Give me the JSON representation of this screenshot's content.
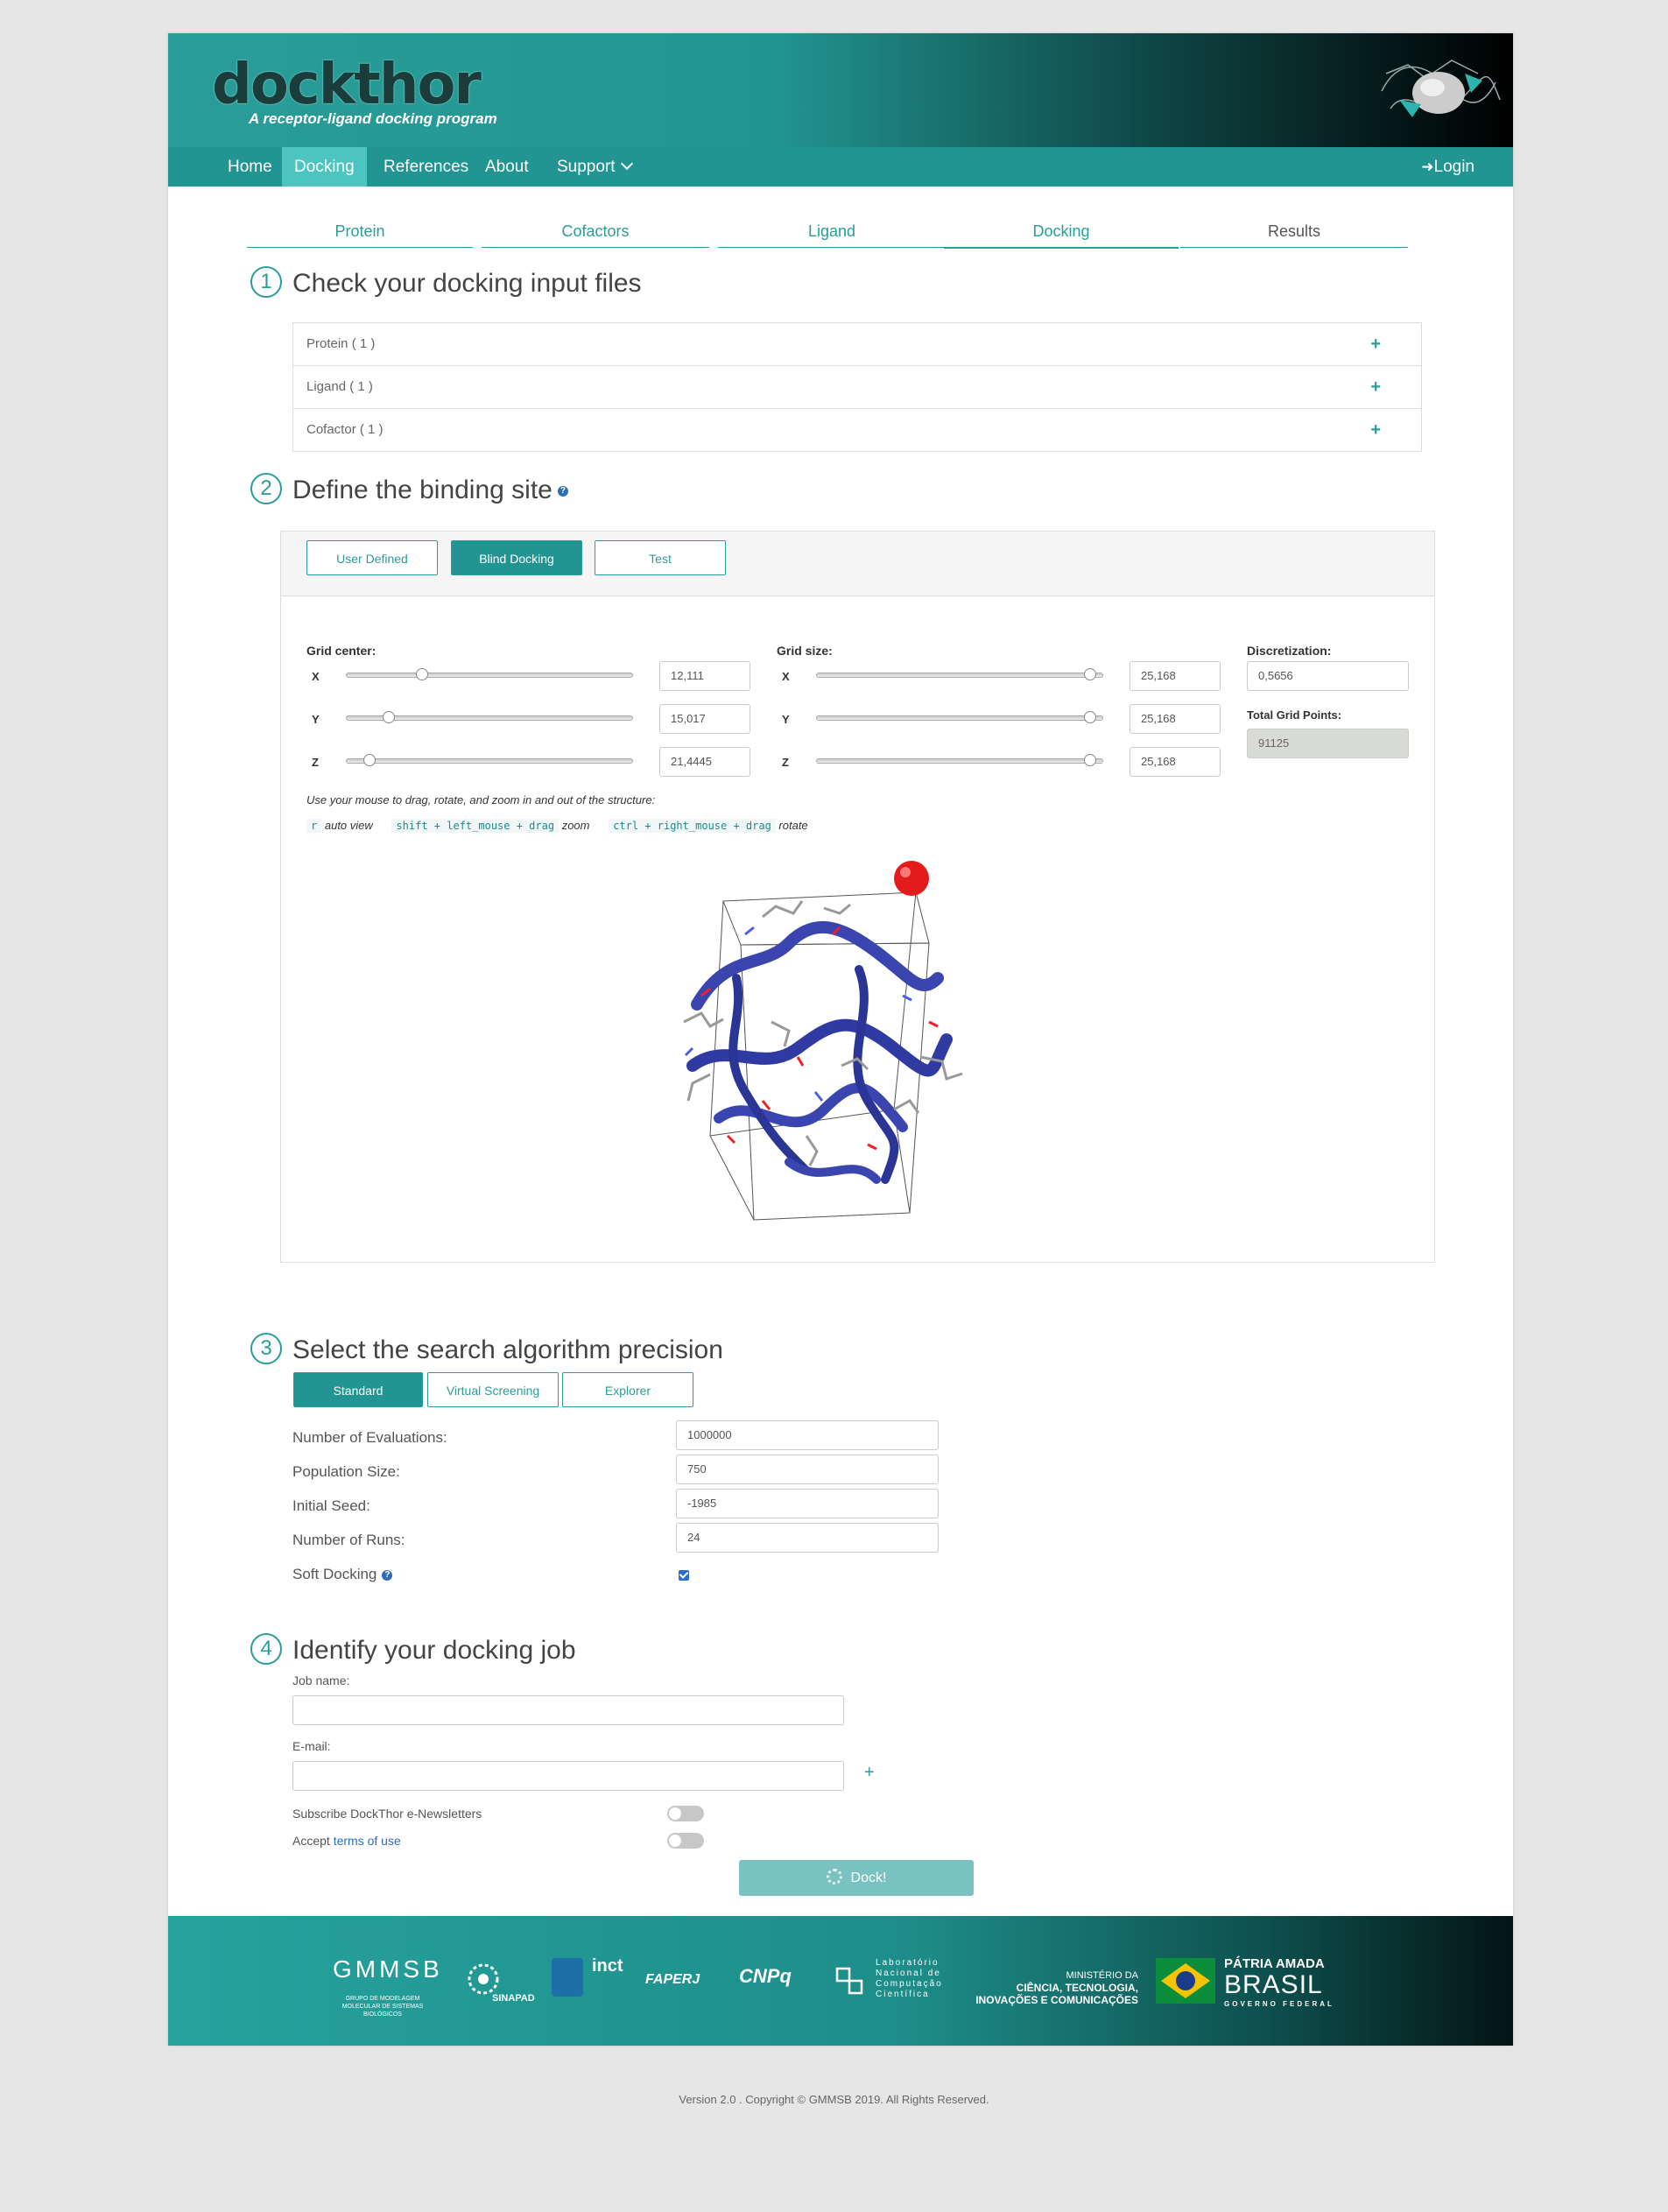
{
  "header": {
    "logo": "dockthor",
    "tagline": "A receptor-ligand docking program"
  },
  "nav": {
    "items": [
      "Home",
      "Docking",
      "References",
      "About",
      "Support"
    ],
    "active": "Docking",
    "login": "Login"
  },
  "steps": [
    "Protein",
    "Cofactors",
    "Ligand",
    "Docking",
    "Results"
  ],
  "section1": {
    "num": "1",
    "title": "Check your docking input files",
    "rows": [
      "Protein ( 1 )",
      "Ligand ( 1 )",
      "Cofactor ( 1 )"
    ],
    "plus": "+"
  },
  "section2": {
    "num": "2",
    "title": "Define the binding site",
    "help": "?",
    "modes": [
      "User Defined",
      "Blind Docking",
      "Test"
    ],
    "active_mode": "Blind Docking",
    "grid_center_label": "Grid center:",
    "grid_size_label": "Grid size:",
    "axes": [
      "X",
      "Y",
      "Z"
    ],
    "grid_center": [
      "12,111",
      "15,017",
      "21,4445"
    ],
    "grid_center_slider": [
      0.25,
      0.13,
      0.06
    ],
    "grid_size": [
      "25,168",
      "25,168",
      "25,168"
    ],
    "grid_size_slider": [
      0.97,
      0.97,
      0.97
    ],
    "discretization_label": "Discretization:",
    "discretization": "0,5656",
    "total_points_label": "Total Grid Points:",
    "total_points": "91125",
    "instructions": "Use your mouse to drag, rotate, and zoom in and out of the structure:",
    "keys": {
      "k1": "r",
      "t1": "auto view",
      "k2": "shift + left_mouse + drag",
      "t2": "zoom",
      "k3": "ctrl + right_mouse + drag",
      "t3": "rotate"
    }
  },
  "section3": {
    "num": "3",
    "title": "Select the search algorithm precision",
    "modes": [
      "Standard",
      "Virtual Screening",
      "Explorer"
    ],
    "active_mode": "Standard",
    "params": [
      {
        "label": "Number of Evaluations:",
        "value": "1000000"
      },
      {
        "label": "Population Size:",
        "value": "750"
      },
      {
        "label": "Initial Seed:",
        "value": "-1985"
      },
      {
        "label": "Number of Runs:",
        "value": "24"
      }
    ],
    "soft_docking": "Soft Docking",
    "soft_docking_checked": true
  },
  "section4": {
    "num": "4",
    "title": "Identify your docking job",
    "job_name_label": "Job name:",
    "email_label": "E-mail:",
    "add": "+",
    "subscribe": "Subscribe DockThor e-Newsletters",
    "accept_prefix": "Accept ",
    "accept_link": "terms of use",
    "dock_button": "Dock!"
  },
  "footer": {
    "gmmsb": "GMMSB",
    "gmmsb_sub": "GRUPO DE MODELAGEM MOLECULAR DE SISTEMAS BIOLÓGICOS",
    "sinapad": "SINAPAD",
    "inct": "inct",
    "faperj": "FAPERJ",
    "cnpq": "CNPq",
    "lncc": "Laboratório Nacional de Computação Científica",
    "ministerio": "MINISTÉRIO DA",
    "ministerio2": "CIÊNCIA, TECNOLOGIA,",
    "ministerio3": "INOVAÇÕES E COMUNICAÇÕES",
    "brasil1": "PÁTRIA AMADA",
    "brasil2": "BRASIL",
    "brasil3": "GOVERNO FEDERAL"
  },
  "copyright": "Version 2.0 . Copyright © GMMSB 2019. All Rights Reserved."
}
